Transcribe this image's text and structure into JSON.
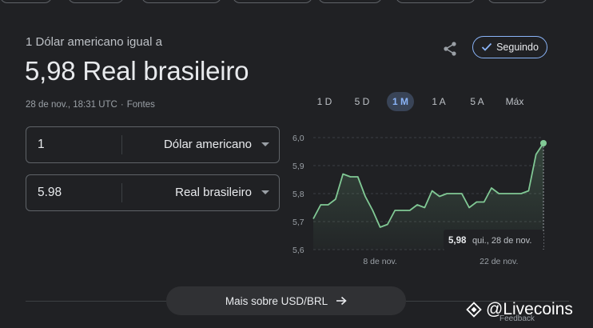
{
  "header": {
    "subtitle": "1 Dólar americano igual a",
    "amount": "5,98 Real brasileiro",
    "timestamp": "28 de nov., 18:31 UTC",
    "separator": "·",
    "sources_link": "Fontes"
  },
  "actions": {
    "share_icon": "share-icon",
    "follow_label": "Seguindo",
    "follow_icon": "check-icon"
  },
  "ranges": [
    {
      "label": "1 D",
      "active": false
    },
    {
      "label": "5 D",
      "active": false
    },
    {
      "label": "1 M",
      "active": true
    },
    {
      "label": "1 A",
      "active": false
    },
    {
      "label": "5 A",
      "active": false
    },
    {
      "label": "Máx",
      "active": false
    }
  ],
  "converter": {
    "from_value": "1",
    "from_currency": "Dólar americano",
    "to_value": "5.98",
    "to_currency": "Real brasileiro"
  },
  "chart_data": {
    "type": "area",
    "title": "",
    "xlabel": "",
    "ylabel": "",
    "ylim": [
      5.6,
      6.0
    ],
    "yticks": [
      "6,0",
      "5,9",
      "5,8",
      "5,7",
      "5,6"
    ],
    "xticks": [
      {
        "index": 9,
        "label": "8 de nov."
      },
      {
        "index": 25,
        "label": "22 de nov."
      }
    ],
    "grid": true,
    "color": "#81c995",
    "series": [
      {
        "values": [
          5.71,
          5.76,
          5.76,
          5.78,
          5.87,
          5.86,
          5.86,
          5.79,
          5.74,
          5.68,
          5.69,
          5.74,
          5.74,
          5.74,
          5.76,
          5.75,
          5.81,
          5.79,
          5.8,
          5.8,
          5.8,
          5.75,
          5.77,
          5.77,
          5.82,
          5.8,
          5.8,
          5.8,
          5.8,
          5.81,
          5.94,
          5.98
        ]
      }
    ],
    "tooltip": {
      "value": "5,98",
      "date": "qui., 28 de nov."
    }
  },
  "more_button": {
    "label": "Mais sobre USD/BRL",
    "icon": "arrow-right-icon"
  },
  "watermark": {
    "text": "@Livecoins",
    "icon": "livecoins-logo-icon",
    "under_text": "Feedback"
  }
}
